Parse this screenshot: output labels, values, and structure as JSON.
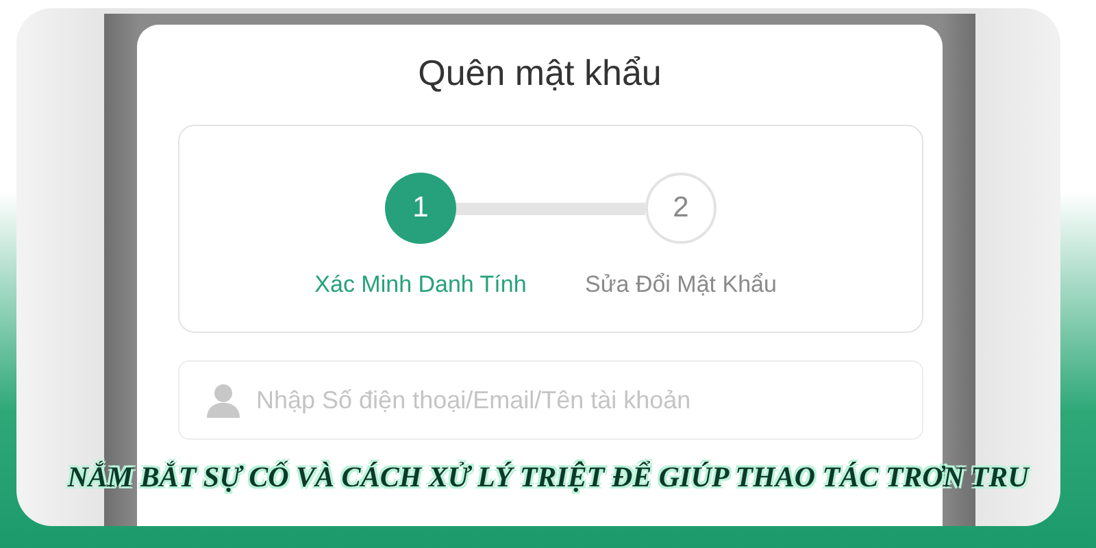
{
  "dialog": {
    "title": "Quên mật khẩu",
    "steps": [
      {
        "number": "1",
        "label": "Xác Minh Danh Tính",
        "selected": true
      },
      {
        "number": "2",
        "label": "Sửa Đổi Mật Khẩu",
        "selected": false
      }
    ],
    "account_field": {
      "placeholder": "Nhập Số điện thoại/Email/Tên tài khoản"
    }
  },
  "caption": "NẮM BẮT SỰ CỐ VÀ CÁCH XỬ LÝ TRIỆT ĐỂ GIÚP THAO TÁC TRƠN TRU"
}
